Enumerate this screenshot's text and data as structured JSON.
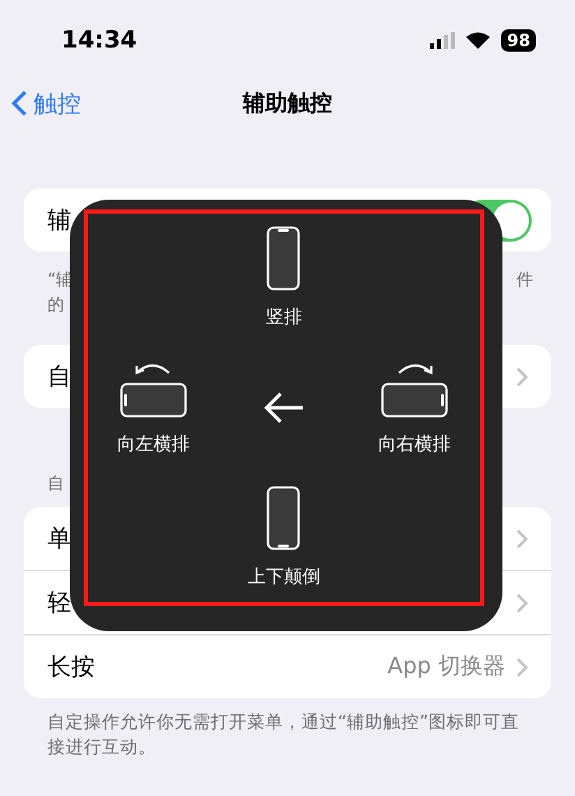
{
  "status_bar": {
    "time": "14:34",
    "battery": "98"
  },
  "nav": {
    "back": "触控",
    "title": "辅助触控"
  },
  "main_toggle": {
    "label": "辅",
    "on": true
  },
  "toggle_footer": {
    "left_lines": [
      "“辅",
      "的"
    ],
    "right": "件"
  },
  "menu_row": {
    "label": "自"
  },
  "section_header": "自",
  "actions": [
    {
      "label": "单"
    },
    {
      "label": "轻"
    },
    {
      "label": "长按",
      "value": "App 切换器"
    }
  ],
  "footer": "自定操作允许你无需打开菜单，通过“辅助触控”图标即可直接进行互动。",
  "overlay": {
    "items": [
      {
        "kind": "portrait",
        "label": "竖排"
      },
      {
        "kind": "left",
        "label": "向左横排"
      },
      {
        "kind": "back"
      },
      {
        "kind": "right",
        "label": "向右横排"
      },
      {
        "kind": "upside",
        "label": "上下颠倒"
      }
    ]
  }
}
